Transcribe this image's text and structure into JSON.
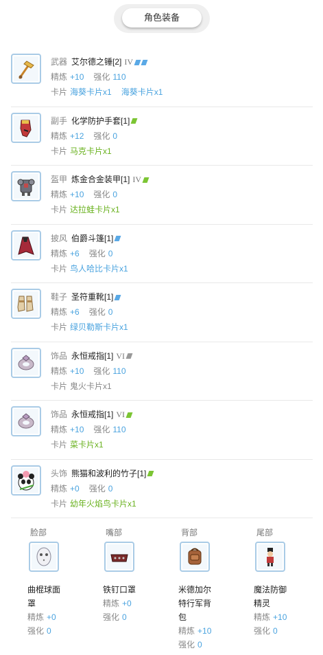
{
  "header": {
    "title": "角色装备"
  },
  "labels": {
    "refine": "精炼",
    "enhance": "强化",
    "card": "卡片"
  },
  "colors": {
    "blue": "#4aa3df",
    "green": "#6ab21f",
    "gray": "#888888",
    "border": "#a9cbe6"
  },
  "equipment": [
    {
      "slot": "武器",
      "name": "艾尔德之锤[2]",
      "grade": "IV",
      "slot_marks": [
        "blue",
        "blue"
      ],
      "icon": "hammer-icon",
      "refine": "+10",
      "enhance": "110",
      "cards": [
        "海葵卡片x1",
        "海葵卡片x1"
      ],
      "card_color": "blue"
    },
    {
      "slot": "副手",
      "name": "化学防护手套[1]",
      "grade": "",
      "slot_marks": [
        "green"
      ],
      "icon": "glove-icon",
      "refine": "+12",
      "enhance": "0",
      "cards": [
        "马克卡片x1"
      ],
      "card_color": "green"
    },
    {
      "slot": "盔甲",
      "name": "炼金合金装甲[1]",
      "grade": "IV",
      "slot_marks": [
        "green"
      ],
      "icon": "armor-icon",
      "refine": "+10",
      "enhance": "0",
      "cards": [
        "达拉蛙卡片x1"
      ],
      "card_color": "green"
    },
    {
      "slot": "披风",
      "name": "伯爵斗篷[1]",
      "grade": "",
      "slot_marks": [
        "blue"
      ],
      "icon": "cloak-icon",
      "refine": "+6",
      "enhance": "0",
      "cards": [
        "鸟人哈比卡片x1"
      ],
      "card_color": "blue"
    },
    {
      "slot": "鞋子",
      "name": "圣符重靴[1]",
      "grade": "",
      "slot_marks": [
        "blue"
      ],
      "icon": "boots-icon",
      "refine": "+6",
      "enhance": "0",
      "cards": [
        "绿贝勒斯卡片x1"
      ],
      "card_color": "blue"
    },
    {
      "slot": "饰品",
      "name": "永恒戒指[1]",
      "grade": "VI",
      "slot_marks": [
        "gray"
      ],
      "icon": "ring-icon",
      "refine": "+10",
      "enhance": "110",
      "cards": [
        "鬼火卡片x1"
      ],
      "card_color": "gray"
    },
    {
      "slot": "饰品",
      "name": "永恒戒指[1]",
      "grade": "VI",
      "slot_marks": [
        "green"
      ],
      "icon": "ring-icon",
      "refine": "+10",
      "enhance": "110",
      "cards": [
        "菜卡片x1"
      ],
      "card_color": "green"
    },
    {
      "slot": "头饰",
      "name": "熊猫和波利的竹子[1]",
      "grade": "",
      "slot_marks": [
        "green"
      ],
      "icon": "panda-icon",
      "refine": "+0",
      "enhance": "0",
      "cards": [
        "幼年火焰鸟卡片x1"
      ],
      "card_color": "green"
    }
  ],
  "costumes": [
    {
      "slot": "脸部",
      "name_lines": [
        "曲棍球面",
        "罩"
      ],
      "icon": "hockey-mask-icon",
      "refine": "+0",
      "enhance": "0"
    },
    {
      "slot": "嘴部",
      "name_lines": [
        "铁钉口罩"
      ],
      "icon": "spiked-mask-icon",
      "refine": "+0",
      "enhance": "0"
    },
    {
      "slot": "背部",
      "name_lines": [
        "米德加尔",
        "特行军背",
        "包"
      ],
      "icon": "backpack-icon",
      "refine": "+10",
      "enhance": "0"
    },
    {
      "slot": "尾部",
      "name_lines": [
        "魔法防御",
        "精灵"
      ],
      "icon": "nutcracker-icon",
      "refine": "+10",
      "enhance": "0"
    }
  ]
}
